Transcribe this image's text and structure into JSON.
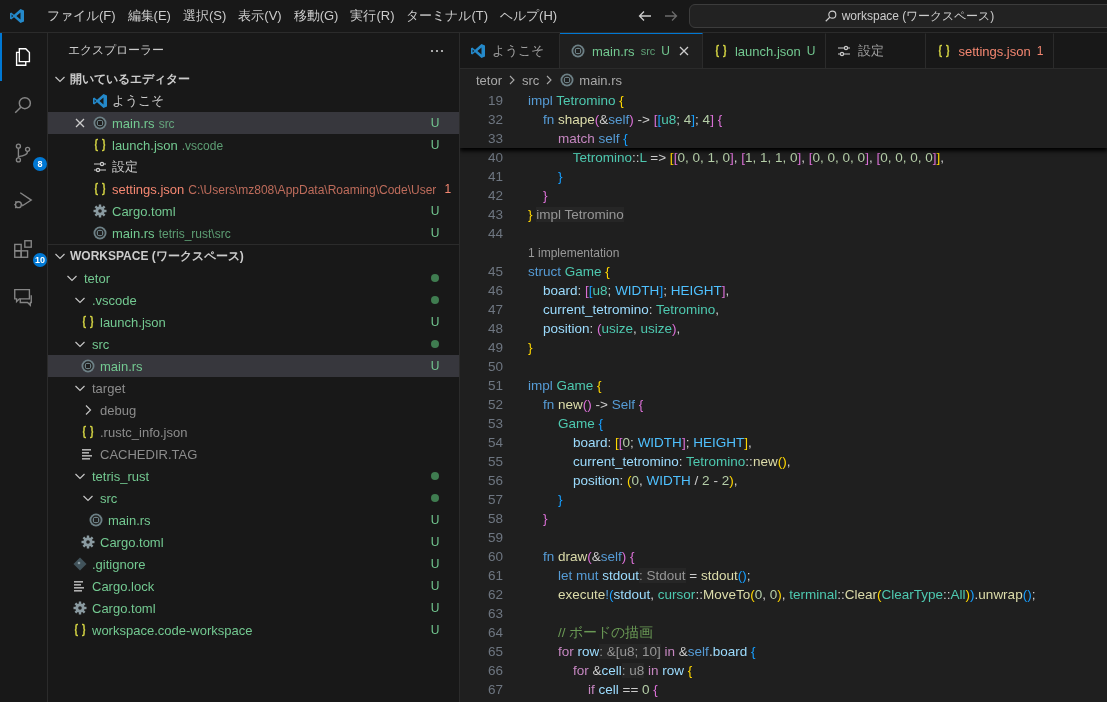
{
  "titlebar": {
    "menus": [
      "ファイル(F)",
      "編集(E)",
      "選択(S)",
      "表示(V)",
      "移動(G)",
      "実行(R)",
      "ターミナル(T)",
      "ヘルプ(H)"
    ],
    "search": "workspace (ワークスペース)"
  },
  "activity_bar": [
    {
      "kind": "explorer",
      "selected": true
    },
    {
      "kind": "search",
      "selected": false
    },
    {
      "kind": "source-control",
      "badge": "8",
      "selected": false
    },
    {
      "kind": "run-debug",
      "selected": false
    },
    {
      "kind": "extensions",
      "badge": "10",
      "selected": false
    },
    {
      "kind": "remote",
      "selected": false
    }
  ],
  "sidebar": {
    "title": "エクスプローラー",
    "open_editors": {
      "title": "開いているエディター",
      "expanded": true,
      "items": [
        {
          "name": "ようこそ",
          "kind": "vscode",
          "color": "#cccccc",
          "selected": false
        },
        {
          "name": "main.rs",
          "kind": "rust",
          "description": "src",
          "color": "#73c991",
          "badge": "U",
          "selected": true
        },
        {
          "name": "launch.json",
          "kind": "json",
          "description": ".vscode",
          "color": "#73c991",
          "badge": "U",
          "selected": false
        },
        {
          "name": "設定",
          "kind": "settings",
          "color": "#cccccc",
          "selected": false
        },
        {
          "name": "settings.json",
          "kind": "json",
          "description": "C:\\Users\\mz808\\AppData\\Roaming\\Code\\User",
          "color": "#f48771",
          "badge": "1",
          "selected": false
        },
        {
          "name": "Cargo.toml",
          "kind": "toml",
          "color": "#73c991",
          "badge": "U",
          "selected": false
        },
        {
          "name": "main.rs",
          "kind": "rust",
          "description": "tetris_rust\\src",
          "color": "#73c991",
          "badge": "U",
          "selected": false
        }
      ]
    },
    "workspace": {
      "title": "WORKSPACE (ワークスペース)",
      "expanded": true,
      "tree": [
        {
          "name": "tetor",
          "kind": "folder",
          "expanded": true,
          "color": "#73c991",
          "dot": true,
          "selected": false,
          "children": [
            {
              "name": ".vscode",
              "kind": "folder",
              "expanded": true,
              "color": "#73c991",
              "dot": true,
              "selected": false,
              "children": [
                {
                  "name": "launch.json",
                  "kind": "json",
                  "color": "#73c991",
                  "dot": false,
                  "badge": "U",
                  "selected": false
                }
              ]
            },
            {
              "name": "src",
              "kind": "folder",
              "expanded": true,
              "color": "#73c991",
              "dot": true,
              "selected": false,
              "children": [
                {
                  "name": "main.rs",
                  "kind": "rust",
                  "color": "#73c991",
                  "dot": false,
                  "badge": "U",
                  "selected": true
                }
              ]
            },
            {
              "name": "target",
              "kind": "folder",
              "expanded": true,
              "color": "#8c8c8c",
              "dot": false,
              "selected": false,
              "children": [
                {
                  "name": "debug",
                  "kind": "folder",
                  "expanded": false,
                  "color": "#8c8c8c",
                  "dot": false,
                  "selected": false
                },
                {
                  "name": ".rustc_info.json",
                  "kind": "json",
                  "color": "#8c8c8c",
                  "dot": false,
                  "selected": false
                },
                {
                  "name": "CACHEDIR.TAG",
                  "kind": "text",
                  "color": "#8c8c8c",
                  "dot": false,
                  "selected": false
                }
              ]
            },
            {
              "name": "tetris_rust",
              "kind": "folder",
              "expanded": true,
              "color": "#73c991",
              "dot": true,
              "selected": false,
              "children": [
                {
                  "name": "src",
                  "kind": "folder",
                  "expanded": true,
                  "color": "#73c991",
                  "dot": true,
                  "selected": false,
                  "children": [
                    {
                      "name": "main.rs",
                      "kind": "rust",
                      "color": "#73c991",
                      "dot": false,
                      "badge": "U",
                      "selected": false
                    }
                  ]
                },
                {
                  "name": "Cargo.toml",
                  "kind": "toml",
                  "color": "#73c991",
                  "dot": false,
                  "badge": "U",
                  "selected": false
                }
              ]
            },
            {
              "name": ".gitignore",
              "kind": "git",
              "color": "#73c991",
              "dot": false,
              "badge": "U",
              "selected": false
            },
            {
              "name": "Cargo.lock",
              "kind": "text",
              "color": "#73c991",
              "dot": false,
              "badge": "U",
              "selected": false
            },
            {
              "name": "Cargo.toml",
              "kind": "toml",
              "color": "#73c991",
              "dot": false,
              "badge": "U",
              "selected": false
            },
            {
              "name": "workspace.code-workspace",
              "kind": "json",
              "color": "#73c991",
              "dot": false,
              "badge": "U",
              "selected": false
            }
          ]
        }
      ]
    }
  },
  "tabs": [
    {
      "label": "ようこそ",
      "kind": "vscode",
      "color": "#a0a0a0",
      "selected": false
    },
    {
      "label": "main.rs",
      "kind": "rust",
      "description": "src",
      "color": "#73c991",
      "badge": "U",
      "selected": true
    },
    {
      "label": "launch.json",
      "kind": "json",
      "color": "#73c991",
      "badge": "U",
      "selected": false
    },
    {
      "label": "設定",
      "kind": "settings",
      "color": "#a0a0a0",
      "selected": false
    },
    {
      "label": "settings.json",
      "kind": "json",
      "color": "#f48771",
      "badge": "1",
      "selected": false
    }
  ],
  "breadcrumb": [
    {
      "label": "tetor",
      "kind": "folder"
    },
    {
      "label": "src",
      "kind": "folder"
    },
    {
      "label": "main.rs",
      "kind": "rust"
    }
  ],
  "editor": {
    "sticky_scroll": [
      {
        "kind": "code",
        "number": "19",
        "tokens": [
          {
            "text": "impl ",
            "kind": "kw"
          },
          {
            "text": "Tetromino ",
            "kind": "type"
          },
          {
            "text": "{",
            "kind": "b1"
          }
        ]
      },
      {
        "kind": "code",
        "number": "32",
        "tokens": [
          {
            "text": "    fn ",
            "kind": "kw"
          },
          {
            "text": "shape",
            "kind": "fn"
          },
          {
            "text": "(",
            "kind": "b2"
          },
          {
            "text": "&",
            "kind": "plain"
          },
          {
            "text": "self",
            "kind": "kw"
          },
          {
            "text": ")",
            "kind": "b2"
          },
          {
            "text": " -> ",
            "kind": "plain"
          },
          {
            "text": "[",
            "kind": "b2"
          },
          {
            "text": "[",
            "kind": "b3"
          },
          {
            "text": "u8",
            "kind": "type"
          },
          {
            "text": "; ",
            "kind": "plain"
          },
          {
            "text": "4",
            "kind": "num"
          },
          {
            "text": "]",
            "kind": "b3"
          },
          {
            "text": "; ",
            "kind": "plain"
          },
          {
            "text": "4",
            "kind": "num"
          },
          {
            "text": "] {",
            "kind": "b2"
          }
        ]
      },
      {
        "kind": "code",
        "number": "33",
        "tokens": [
          {
            "text": "        match ",
            "kind": "ctrl"
          },
          {
            "text": "self ",
            "kind": "kw"
          },
          {
            "text": "{",
            "kind": "b3"
          }
        ]
      }
    ],
    "lines": [
      {
        "kind": "code",
        "number": "40",
        "tokens": [
          {
            "text": "            Tetromino",
            "kind": "type"
          },
          {
            "text": "::",
            "kind": "plain"
          },
          {
            "text": "L",
            "kind": "type"
          },
          {
            "text": " => ",
            "kind": "plain"
          },
          {
            "text": "[",
            "kind": "b1"
          },
          {
            "text": "[",
            "kind": "b2"
          },
          {
            "text": "0, 0, 1, 0",
            "kind": "num"
          },
          {
            "text": "]",
            "kind": "b2"
          },
          {
            "text": ", ",
            "kind": "plain"
          },
          {
            "text": "[",
            "kind": "b2"
          },
          {
            "text": "1, 1, 1, 0",
            "kind": "num"
          },
          {
            "text": "]",
            "kind": "b2"
          },
          {
            "text": ", ",
            "kind": "plain"
          },
          {
            "text": "[",
            "kind": "b2"
          },
          {
            "text": "0, 0, 0, 0",
            "kind": "num"
          },
          {
            "text": "]",
            "kind": "b2"
          },
          {
            "text": ", ",
            "kind": "plain"
          },
          {
            "text": "[",
            "kind": "b2"
          },
          {
            "text": "0, 0, 0, 0",
            "kind": "num"
          },
          {
            "text": "]",
            "kind": "b2"
          },
          {
            "text": "]",
            "kind": "b1"
          },
          {
            "text": ",",
            "kind": "plain"
          }
        ]
      },
      {
        "kind": "code",
        "number": "41",
        "tokens": [
          {
            "text": "        }",
            "kind": "b3"
          }
        ]
      },
      {
        "kind": "code",
        "number": "42",
        "tokens": [
          {
            "text": "    }",
            "kind": "b2"
          }
        ]
      },
      {
        "kind": "code",
        "number": "43",
        "tokens": [
          {
            "text": "} ",
            "kind": "b1"
          },
          {
            "text": "impl Tetromino",
            "kind": "hint"
          }
        ]
      },
      {
        "kind": "code",
        "number": "44"
      },
      {
        "kind": "lens",
        "text": "1 implementation"
      },
      {
        "kind": "code",
        "number": "45",
        "tokens": [
          {
            "text": "struct ",
            "kind": "kw"
          },
          {
            "text": "Game ",
            "kind": "type"
          },
          {
            "text": "{",
            "kind": "b1"
          }
        ]
      },
      {
        "kind": "code",
        "number": "46",
        "tokens": [
          {
            "text": "    board",
            "kind": "var"
          },
          {
            "text": ": ",
            "kind": "plain"
          },
          {
            "text": "[",
            "kind": "b2"
          },
          {
            "text": "[",
            "kind": "b3"
          },
          {
            "text": "u8",
            "kind": "type"
          },
          {
            "text": "; ",
            "kind": "plain"
          },
          {
            "text": "WIDTH",
            "kind": "const"
          },
          {
            "text": "]",
            "kind": "b3"
          },
          {
            "text": "; ",
            "kind": "plain"
          },
          {
            "text": "HEIGHT",
            "kind": "const"
          },
          {
            "text": "]",
            "kind": "b2"
          },
          {
            "text": ",",
            "kind": "plain"
          }
        ]
      },
      {
        "kind": "code",
        "number": "47",
        "tokens": [
          {
            "text": "    current_tetromino",
            "kind": "var"
          },
          {
            "text": ": ",
            "kind": "plain"
          },
          {
            "text": "Tetromino",
            "kind": "type"
          },
          {
            "text": ",",
            "kind": "plain"
          }
        ]
      },
      {
        "kind": "code",
        "number": "48",
        "tokens": [
          {
            "text": "    position",
            "kind": "var"
          },
          {
            "text": ": ",
            "kind": "plain"
          },
          {
            "text": "(",
            "kind": "b2"
          },
          {
            "text": "usize",
            "kind": "type"
          },
          {
            "text": ", ",
            "kind": "plain"
          },
          {
            "text": "usize",
            "kind": "type"
          },
          {
            "text": ")",
            "kind": "b2"
          },
          {
            "text": ",",
            "kind": "plain"
          }
        ]
      },
      {
        "kind": "code",
        "number": "49",
        "tokens": [
          {
            "text": "}",
            "kind": "b1"
          }
        ]
      },
      {
        "kind": "code",
        "number": "50"
      },
      {
        "kind": "code",
        "number": "51",
        "tokens": [
          {
            "text": "impl ",
            "kind": "kw"
          },
          {
            "text": "Game ",
            "kind": "type"
          },
          {
            "text": "{",
            "kind": "b1"
          }
        ]
      },
      {
        "kind": "code",
        "number": "52",
        "tokens": [
          {
            "text": "    fn ",
            "kind": "kw"
          },
          {
            "text": "new",
            "kind": "fn"
          },
          {
            "text": "()",
            "kind": "b2"
          },
          {
            "text": " -> ",
            "kind": "plain"
          },
          {
            "text": "Self ",
            "kind": "kw"
          },
          {
            "text": "{",
            "kind": "b2"
          }
        ]
      },
      {
        "kind": "code",
        "number": "53",
        "tokens": [
          {
            "text": "        Game ",
            "kind": "type"
          },
          {
            "text": "{",
            "kind": "b3"
          }
        ]
      },
      {
        "kind": "code",
        "number": "54",
        "tokens": [
          {
            "text": "            board",
            "kind": "var"
          },
          {
            "text": ": ",
            "kind": "plain"
          },
          {
            "text": "[",
            "kind": "b1"
          },
          {
            "text": "[",
            "kind": "b2"
          },
          {
            "text": "0",
            "kind": "num"
          },
          {
            "text": "; ",
            "kind": "plain"
          },
          {
            "text": "WIDTH",
            "kind": "const"
          },
          {
            "text": "]",
            "kind": "b2"
          },
          {
            "text": "; ",
            "kind": "plain"
          },
          {
            "text": "HEIGHT",
            "kind": "const"
          },
          {
            "text": "]",
            "kind": "b1"
          },
          {
            "text": ",",
            "kind": "plain"
          }
        ]
      },
      {
        "kind": "code",
        "number": "55",
        "tokens": [
          {
            "text": "            current_tetromino",
            "kind": "var"
          },
          {
            "text": ": ",
            "kind": "plain"
          },
          {
            "text": "Tetromino",
            "kind": "type"
          },
          {
            "text": "::",
            "kind": "plain"
          },
          {
            "text": "new",
            "kind": "fn"
          },
          {
            "text": "()",
            "kind": "b1"
          },
          {
            "text": ",",
            "kind": "plain"
          }
        ]
      },
      {
        "kind": "code",
        "number": "56",
        "tokens": [
          {
            "text": "            position",
            "kind": "var"
          },
          {
            "text": ": ",
            "kind": "plain"
          },
          {
            "text": "(",
            "kind": "b1"
          },
          {
            "text": "0",
            "kind": "num"
          },
          {
            "text": ", ",
            "kind": "plain"
          },
          {
            "text": "WIDTH",
            "kind": "const"
          },
          {
            "text": " / ",
            "kind": "plain"
          },
          {
            "text": "2",
            "kind": "num"
          },
          {
            "text": " - ",
            "kind": "plain"
          },
          {
            "text": "2",
            "kind": "num"
          },
          {
            "text": ")",
            "kind": "b1"
          },
          {
            "text": ",",
            "kind": "plain"
          }
        ]
      },
      {
        "kind": "code",
        "number": "57",
        "tokens": [
          {
            "text": "        }",
            "kind": "b3"
          }
        ]
      },
      {
        "kind": "code",
        "number": "58",
        "tokens": [
          {
            "text": "    }",
            "kind": "b2"
          }
        ]
      },
      {
        "kind": "code",
        "number": "59"
      },
      {
        "kind": "code",
        "number": "60",
        "tokens": [
          {
            "text": "    fn ",
            "kind": "kw"
          },
          {
            "text": "draw",
            "kind": "fn"
          },
          {
            "text": "(",
            "kind": "b2"
          },
          {
            "text": "&",
            "kind": "plain"
          },
          {
            "text": "self",
            "kind": "kw"
          },
          {
            "text": ") {",
            "kind": "b2"
          }
        ]
      },
      {
        "kind": "code",
        "number": "61",
        "tokens": [
          {
            "text": "        let mut ",
            "kind": "kw"
          },
          {
            "text": "stdout",
            "kind": "var"
          },
          {
            "text": ": Stdout",
            "kind": "hint"
          },
          {
            "text": " = ",
            "kind": "plain"
          },
          {
            "text": "stdout",
            "kind": "fn"
          },
          {
            "text": "()",
            "kind": "b3"
          },
          {
            "text": ";",
            "kind": "plain"
          }
        ]
      },
      {
        "kind": "code",
        "number": "62",
        "tokens": [
          {
            "text": "        execute",
            "kind": "fn"
          },
          {
            "text": "!",
            "kind": "kw"
          },
          {
            "text": "(",
            "kind": "b3"
          },
          {
            "text": "stdout",
            "kind": "var"
          },
          {
            "text": ", ",
            "kind": "plain"
          },
          {
            "text": "cursor",
            "kind": "type"
          },
          {
            "text": "::",
            "kind": "plain"
          },
          {
            "text": "MoveTo",
            "kind": "fn"
          },
          {
            "text": "(",
            "kind": "b1"
          },
          {
            "text": "0",
            "kind": "num"
          },
          {
            "text": ", ",
            "kind": "plain"
          },
          {
            "text": "0",
            "kind": "num"
          },
          {
            "text": ")",
            "kind": "b1"
          },
          {
            "text": ", ",
            "kind": "plain"
          },
          {
            "text": "terminal",
            "kind": "type"
          },
          {
            "text": "::",
            "kind": "plain"
          },
          {
            "text": "Clear",
            "kind": "fn"
          },
          {
            "text": "(",
            "kind": "b1"
          },
          {
            "text": "ClearType",
            "kind": "type"
          },
          {
            "text": "::",
            "kind": "plain"
          },
          {
            "text": "All",
            "kind": "type"
          },
          {
            "text": ")",
            "kind": "b1"
          },
          {
            "text": ")",
            "kind": "b3"
          },
          {
            "text": ".",
            "kind": "plain"
          },
          {
            "text": "unwrap",
            "kind": "fn"
          },
          {
            "text": "()",
            "kind": "b3"
          },
          {
            "text": ";",
            "kind": "plain"
          }
        ]
      },
      {
        "kind": "code",
        "number": "63"
      },
      {
        "kind": "code",
        "number": "64",
        "tokens": [
          {
            "text": "        // ボードの描画",
            "kind": "comment"
          }
        ]
      },
      {
        "kind": "code",
        "number": "65",
        "tokens": [
          {
            "text": "        for ",
            "kind": "ctrl"
          },
          {
            "text": "row",
            "kind": "var"
          },
          {
            "text": ": &[u8; 10]",
            "kind": "hint"
          },
          {
            "text": " in ",
            "kind": "ctrl"
          },
          {
            "text": "&",
            "kind": "plain"
          },
          {
            "text": "self",
            "kind": "kw"
          },
          {
            "text": ".",
            "kind": "plain"
          },
          {
            "text": "board ",
            "kind": "var"
          },
          {
            "text": "{",
            "kind": "b3"
          }
        ]
      },
      {
        "kind": "code",
        "number": "66",
        "tokens": [
          {
            "text": "            for ",
            "kind": "ctrl"
          },
          {
            "text": "&",
            "kind": "plain"
          },
          {
            "text": "cell",
            "kind": "var"
          },
          {
            "text": ": u8",
            "kind": "hint"
          },
          {
            "text": " in ",
            "kind": "ctrl"
          },
          {
            "text": "row ",
            "kind": "var"
          },
          {
            "text": "{",
            "kind": "b1"
          }
        ]
      },
      {
        "kind": "code",
        "number": "67",
        "tokens": [
          {
            "text": "                if ",
            "kind": "ctrl"
          },
          {
            "text": "cell",
            "kind": "var"
          },
          {
            "text": " == ",
            "kind": "plain"
          },
          {
            "text": "0 ",
            "kind": "num"
          },
          {
            "text": "{",
            "kind": "b2"
          }
        ]
      }
    ]
  }
}
